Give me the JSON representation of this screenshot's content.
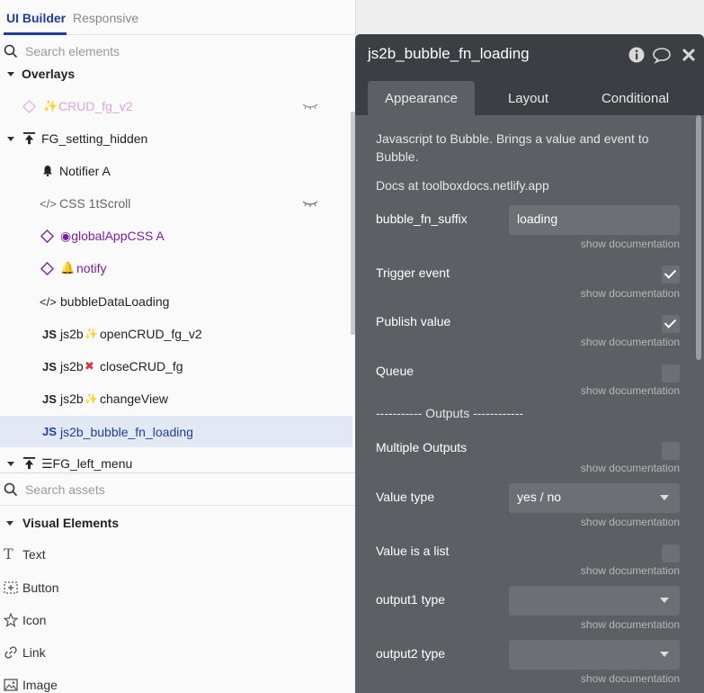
{
  "left_tabs": {
    "ui_builder": "UI Builder",
    "responsive": "Responsive"
  },
  "search_elements": {
    "placeholder": "Search elements"
  },
  "tree": [
    {
      "label": "Overlays"
    },
    {
      "label": "CRUD_fg_v2"
    },
    {
      "label": "FG_setting_hidden"
    },
    {
      "label": "Notifier A"
    },
    {
      "label": "CSS 1tScroll"
    },
    {
      "label": "◉globalAppCSS A"
    },
    {
      "label": "notify"
    },
    {
      "label": "bubbleDataLoading"
    },
    {
      "label": "js2b",
      "label2": "openCRUD_fg_v2"
    },
    {
      "label": "js2b",
      "label2": "closeCRUD_fg"
    },
    {
      "label": "js2b",
      "label2": "changeView"
    },
    {
      "label": "js2b_bubble_fn_loading"
    },
    {
      "label": "☰FG_left_menu"
    }
  ],
  "js_tag": "JS",
  "search_assets": {
    "placeholder": "Search assets"
  },
  "visual_elements": {
    "heading": "Visual Elements",
    "items": [
      "Text",
      "Button",
      "Icon",
      "Link",
      "Image"
    ]
  },
  "panel": {
    "title": "js2b_bubble_fn_loading",
    "tabs": [
      "Appearance",
      "Layout",
      "Conditional"
    ],
    "description": "Javascript to Bubble. Brings a value and event to Bubble.",
    "docs": "Docs at toolboxdocs.netlify.app",
    "show_doc": "show documentation",
    "fields": {
      "suffix_label": "bubble_fn_suffix",
      "suffix_value": "loading",
      "trigger_label": "Trigger event",
      "publish_label": "Publish value",
      "queue_label": "Queue",
      "outputs_sep": "----------- Outputs ------------",
      "multiple_label": "Multiple Outputs",
      "value_type_label": "Value type",
      "value_type_value": "yes / no",
      "value_list_label": "Value is a list",
      "output1_label": "output1 type",
      "output2_label": "output2 type"
    }
  },
  "colors": {
    "accent": "#1f3e9c",
    "panel_bg": "#5c5f63",
    "panel_header": "#3b3e42",
    "purple_item": "#7b1fa2"
  }
}
